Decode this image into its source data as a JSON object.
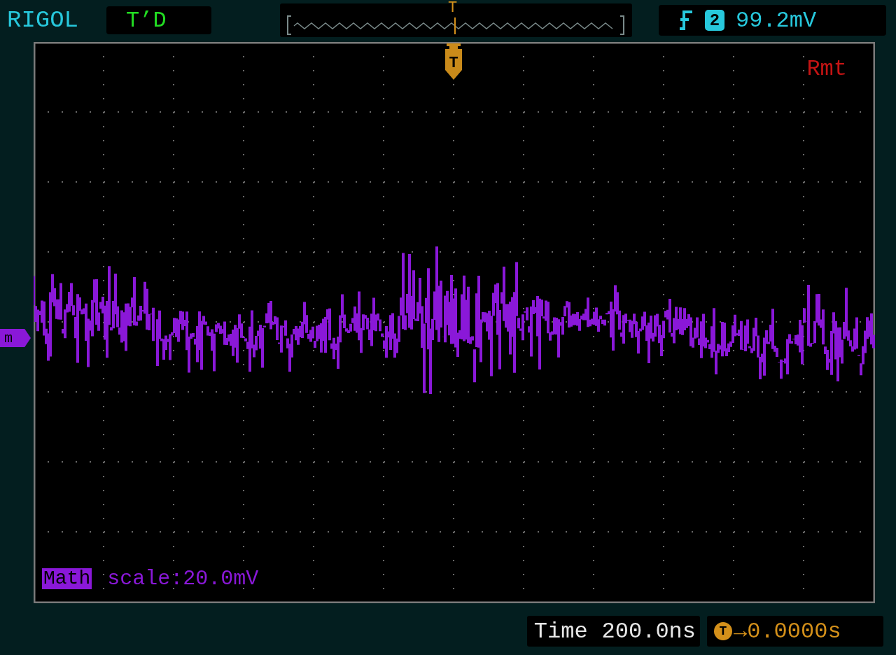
{
  "header": {
    "brand": "RIGOL",
    "status": "T’D"
  },
  "memory_bar": {
    "trigger_marker": "T"
  },
  "trigger": {
    "source": "2",
    "reading": "99.2mV"
  },
  "screen": {
    "trigger_marker": "T",
    "remote": "Rmt",
    "math_marker": "m",
    "math_label": "Math",
    "math_scale": "scale:20.0mV"
  },
  "timebase": {
    "label": "Time",
    "value": "200.0ns"
  },
  "delay": {
    "marker": "T",
    "value": "→0.0000s"
  }
}
